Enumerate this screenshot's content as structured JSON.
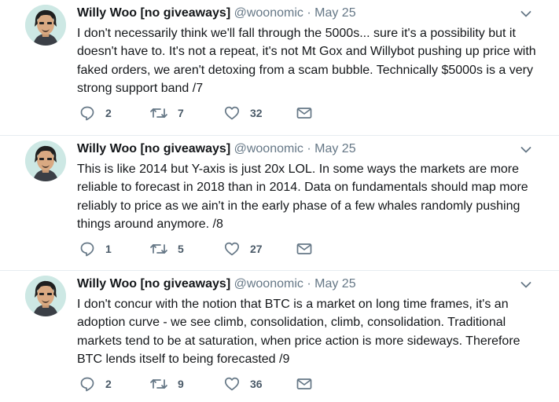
{
  "tweets": [
    {
      "author": "Willy Woo [no giveaways]",
      "handle": "@woonomic",
      "separator": "·",
      "date": "May 25",
      "text": "I don't necessarily think we'll fall through the 5000s... sure it's a possibility but it doesn't have to. It's not a repeat, it's not Mt Gox and Willybot pushing up price with faked orders, we aren't detoxing from a scam bubble. Technically $5000s is a very strong support band /7",
      "replies": "2",
      "retweets": "7",
      "likes": "32"
    },
    {
      "author": "Willy Woo [no giveaways]",
      "handle": "@woonomic",
      "separator": "·",
      "date": "May 25",
      "text": "This is like 2014 but Y-axis is just 20x LOL. In some ways the markets are more reliable to forecast in 2018 than in 2014. Data on fundamentals should map more reliably to price as we ain't in the early phase of a few whales randomly pushing things around anymore. /8",
      "replies": "1",
      "retweets": "5",
      "likes": "27"
    },
    {
      "author": "Willy Woo [no giveaways]",
      "handle": "@woonomic",
      "separator": "·",
      "date": "May 25",
      "text": "I don't concur with the notion that BTC is a market on long time frames, it's an adoption curve - we see climb, consolidation, climb, consolidation. Traditional markets tend to be at saturation, when price action is more sideways. Therefore BTC lends itself to being forecasted /9",
      "replies": "2",
      "retweets": "9",
      "likes": "36"
    }
  ],
  "icons": {
    "reply": "reply-icon",
    "retweet": "retweet-icon",
    "like": "heart-icon",
    "message": "envelope-icon",
    "menu": "chevron-down-icon"
  },
  "colors": {
    "text": "#14171a",
    "muted": "#657786",
    "divider": "#e6ecf0",
    "avatar_bg": "#cde8e4"
  }
}
